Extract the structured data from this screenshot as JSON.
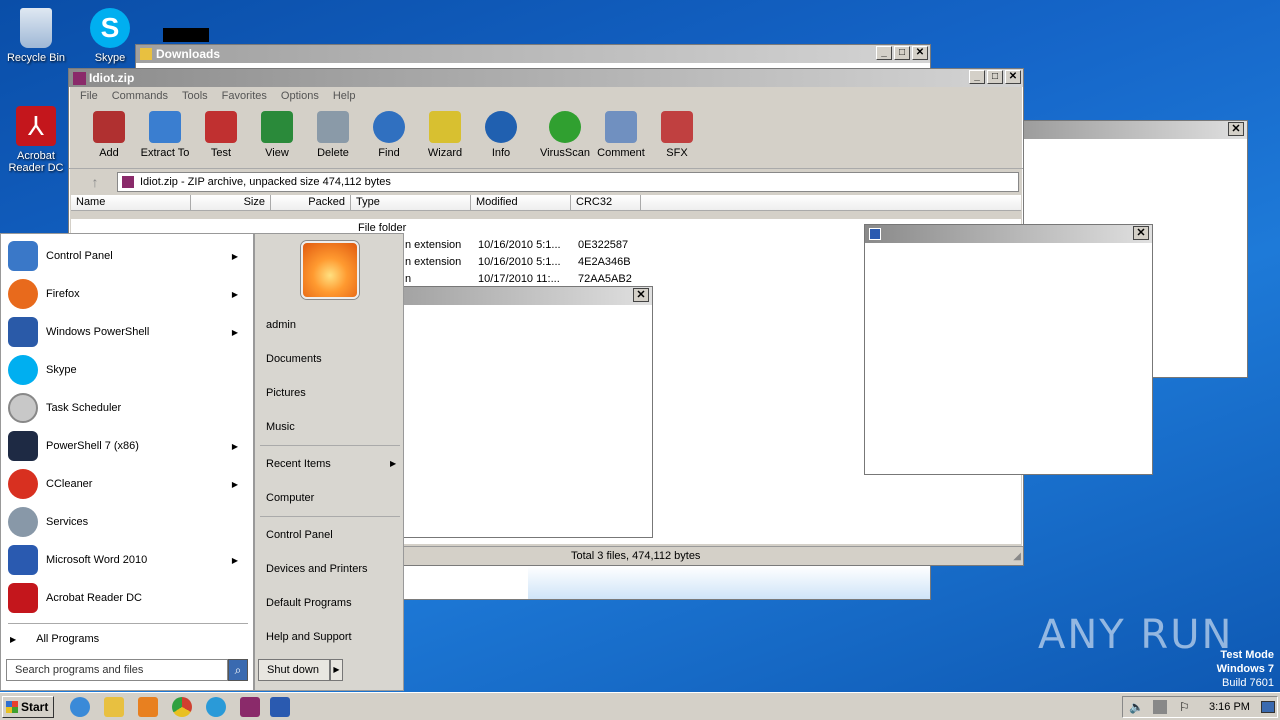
{
  "desktop": {
    "icons": [
      {
        "label": "Recycle Bin",
        "color": "#9fb8d6"
      },
      {
        "label": "Skype",
        "color": "#00aff0"
      },
      {
        "label": "Acrobat Reader DC",
        "color": "#c4161c"
      },
      {
        "label": "",
        "color": "#e84c1c"
      }
    ],
    "watermark": "ANY RUN",
    "test_mode": [
      "Test Mode",
      "Windows 7",
      "Build 7601"
    ]
  },
  "downloads_window": {
    "title": "Downloads"
  },
  "winrar": {
    "title": "Idiot.zip",
    "menu": [
      "File",
      "Commands",
      "Tools",
      "Favorites",
      "Options",
      "Help"
    ],
    "tools": [
      {
        "label": "Add",
        "color": "#b03030"
      },
      {
        "label": "Extract To",
        "color": "#3a7ed0"
      },
      {
        "label": "Test",
        "color": "#c03030"
      },
      {
        "label": "View",
        "color": "#2a8a3a"
      },
      {
        "label": "Delete",
        "color": "#8a9aa8"
      },
      {
        "label": "Find",
        "color": "#3070c0"
      },
      {
        "label": "Wizard",
        "color": "#d8c030"
      },
      {
        "label": "Info",
        "color": "#2060b0"
      },
      {
        "label": "VirusScan",
        "color": "#30a030"
      },
      {
        "label": "Comment",
        "color": "#7090c0"
      },
      {
        "label": "SFX",
        "color": "#c04040"
      }
    ],
    "address": "Idiot.zip - ZIP archive, unpacked size 474,112 bytes",
    "columns": [
      "Name",
      "Size",
      "Packed",
      "Type",
      "Modified",
      "CRC32"
    ],
    "rows": [
      {
        "type": "File folder",
        "modified": "",
        "crc": ""
      },
      {
        "type": "n extension",
        "modified": "10/16/2010 5:1...",
        "crc": "0E322587"
      },
      {
        "type": "n extension",
        "modified": "10/16/2010 5:1...",
        "crc": "4E2A346B"
      },
      {
        "type": "n",
        "modified": "10/17/2010 11:...",
        "crc": "72AA5AB2"
      }
    ],
    "status": "Total 3 files, 474,112 bytes"
  },
  "start_menu": {
    "programs": [
      {
        "label": "Control Panel",
        "arrow": true,
        "color": "#3a78c8"
      },
      {
        "label": "Firefox",
        "arrow": true,
        "color": "#e86a1c"
      },
      {
        "label": "Windows PowerShell",
        "arrow": true,
        "color": "#2a5aa8"
      },
      {
        "label": "Skype",
        "arrow": false,
        "color": "#00aff0"
      },
      {
        "label": "Task Scheduler",
        "arrow": false,
        "color": "#c8c8c8"
      },
      {
        "label": "PowerShell 7 (x86)",
        "arrow": true,
        "color": "#1e2a44"
      },
      {
        "label": "CCleaner",
        "arrow": true,
        "color": "#d83020"
      },
      {
        "label": "Services",
        "arrow": false,
        "color": "#8898a8"
      },
      {
        "label": "Microsoft Word 2010",
        "arrow": true,
        "color": "#2a5ab0"
      },
      {
        "label": "Acrobat Reader DC",
        "arrow": false,
        "color": "#c4161c"
      }
    ],
    "all_programs": "All Programs",
    "search_placeholder": "Search programs and files",
    "right": {
      "user": "admin",
      "group1": [
        "Documents",
        "Pictures",
        "Music"
      ],
      "recent": "Recent Items",
      "computer": "Computer",
      "group3": [
        "Control Panel",
        "Devices and Printers",
        "Default Programs",
        "Help and Support"
      ]
    },
    "shutdown": "Shut down"
  },
  "taskbar": {
    "start": "Start",
    "clock": "3:16 PM",
    "apps": [
      {
        "name": "ie-icon",
        "color": "#3a8ad8"
      },
      {
        "name": "explorer-icon",
        "color": "#e8c040"
      },
      {
        "name": "media-player-icon",
        "color": "#e88020"
      },
      {
        "name": "chrome-icon",
        "color": "#d04030"
      },
      {
        "name": "edge-icon",
        "color": "#2a9ad8"
      },
      {
        "name": "winrar-icon",
        "color": "#8a2a6a"
      },
      {
        "name": "word-icon",
        "color": "#2a5ab0"
      }
    ]
  }
}
